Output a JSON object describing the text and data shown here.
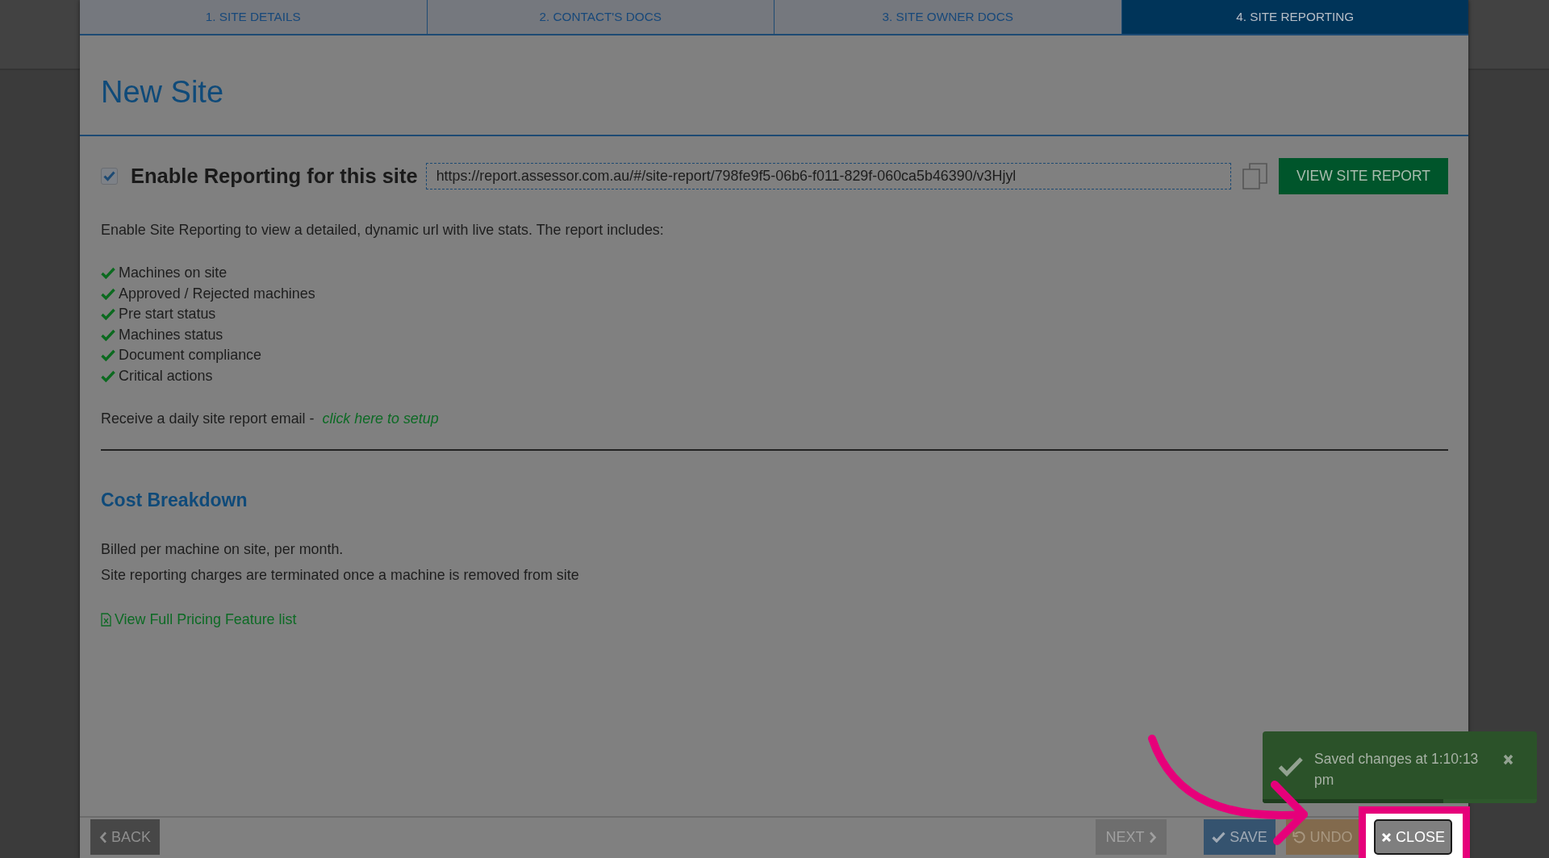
{
  "tabs": [
    {
      "label": "1. SITE DETAILS",
      "selected": false
    },
    {
      "label": "2. CONTACT'S DOCS",
      "selected": false
    },
    {
      "label": "3. SITE OWNER DOCS",
      "selected": false
    },
    {
      "label": "4. SITE REPORTING",
      "selected": true
    }
  ],
  "header": {
    "title": "New Site"
  },
  "reporting": {
    "enabled": true,
    "label": "Enable Reporting for this site",
    "url": "https://report.assessor.com.au/#/site-report/798fe9f5-06b6-f011-829f-060ca5b46390/v3Hjyl",
    "view_button": "VIEW SITE REPORT",
    "intro": "Enable Site Reporting to view a detailed, dynamic url with live stats. The report includes:",
    "features": [
      "Machines on site",
      "Approved / Rejected machines",
      "Pre start status",
      "Machines status",
      "Document compliance",
      "Critical actions"
    ],
    "email_prompt": "Receive a daily site report email -",
    "email_link": "click here to setup"
  },
  "cost_breakdown": {
    "title": "Cost Breakdown",
    "lines": [
      "Billed per machine on site, per month.",
      "Site reporting charges are terminated once a machine is removed from site"
    ],
    "pricing_link": "View Full Pricing Feature list"
  },
  "footer": {
    "buttons": [
      {
        "label": "BACK",
        "kind": "back",
        "highlighted": false
      },
      {
        "label": "NEXT",
        "kind": "next",
        "highlighted": false
      },
      {
        "label": "SAVE",
        "kind": "save",
        "highlighted": false
      },
      {
        "label": "UNDO",
        "kind": "undo",
        "highlighted": false
      },
      {
        "label": "CLOSE",
        "kind": "close",
        "highlighted": true
      }
    ]
  },
  "toast": {
    "message": "Saved changes at 1:10:13 pm",
    "level": 0.66
  }
}
